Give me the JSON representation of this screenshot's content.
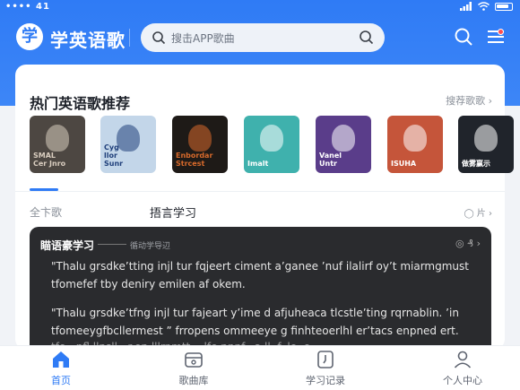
{
  "status": {
    "signal": "•••• 41"
  },
  "app": {
    "logo_glyph": "学",
    "title": "学英语歌"
  },
  "search": {
    "placeholder": "搜击APP歌曲"
  },
  "section": {
    "title": "热门英语歌推荐",
    "more": "搜荐歌歌 ›"
  },
  "covers": [
    {
      "label": "SMAL\nCer Jnro",
      "bg": "#4d4742",
      "fg": "#d9cdbf"
    },
    {
      "label": "Cyg\nllor\nSunr",
      "bg": "#c3d6e9",
      "fg": "#1f3f7a"
    },
    {
      "label": "Enbordar\nStrcest",
      "bg": "#1e1a17",
      "fg": "#d86a2b"
    },
    {
      "label": "Imalt",
      "bg": "#3fb1ad",
      "fg": "#ffffff"
    },
    {
      "label": "Vanel\nUntr",
      "bg": "#5a3d8a",
      "fg": "#ffffff"
    },
    {
      "label": "ISUHA",
      "bg": "#c5553a",
      "fg": "#ffffff"
    },
    {
      "label": "做雾赢示",
      "bg": "#20242b",
      "fg": "#ffffff"
    }
  ],
  "tabs": {
    "tab1": "全卞歌",
    "tab2": "捂言学习",
    "right": "◯ 片 ›"
  },
  "lyrics": {
    "title": "瞄语豪学习",
    "subtitle": "循动学导辺",
    "ctrl": "◎ ₰ ›",
    "para1_line1": "\"Thalu grsdke’tting injl tur fqjeert ciment a’ganee ’nuf ilalirf oy’t miarmgmust",
    "para1_line2": "tfomefef tby deniry emilen af okem.",
    "para2_line1": "\"Thalu grsdke’tfng injl tur fajeart y’ime d afjuheaca tlcstle’ting rqrnablin. ’in",
    "para2_line2": "tfomeeygfbcllermest ” frropens ommeeye g finhteoerlhl er’tacs enpned ert.",
    "para2_line3": "tfe...nfl llnsll...r.en lllrnmtt, ..lfe nnnf...a ll..f..le..e"
  },
  "nav": [
    {
      "label": "首页",
      "icon": "home-icon",
      "active": true
    },
    {
      "label": "歌曲库",
      "icon": "song-library-icon",
      "active": false
    },
    {
      "label": "学习记录",
      "icon": "study-record-icon",
      "active": false
    },
    {
      "label": "个人中心",
      "icon": "user-icon",
      "active": false
    }
  ],
  "colors": {
    "brand": "#2f7bf5",
    "card_dark": "#2a2b2e"
  }
}
